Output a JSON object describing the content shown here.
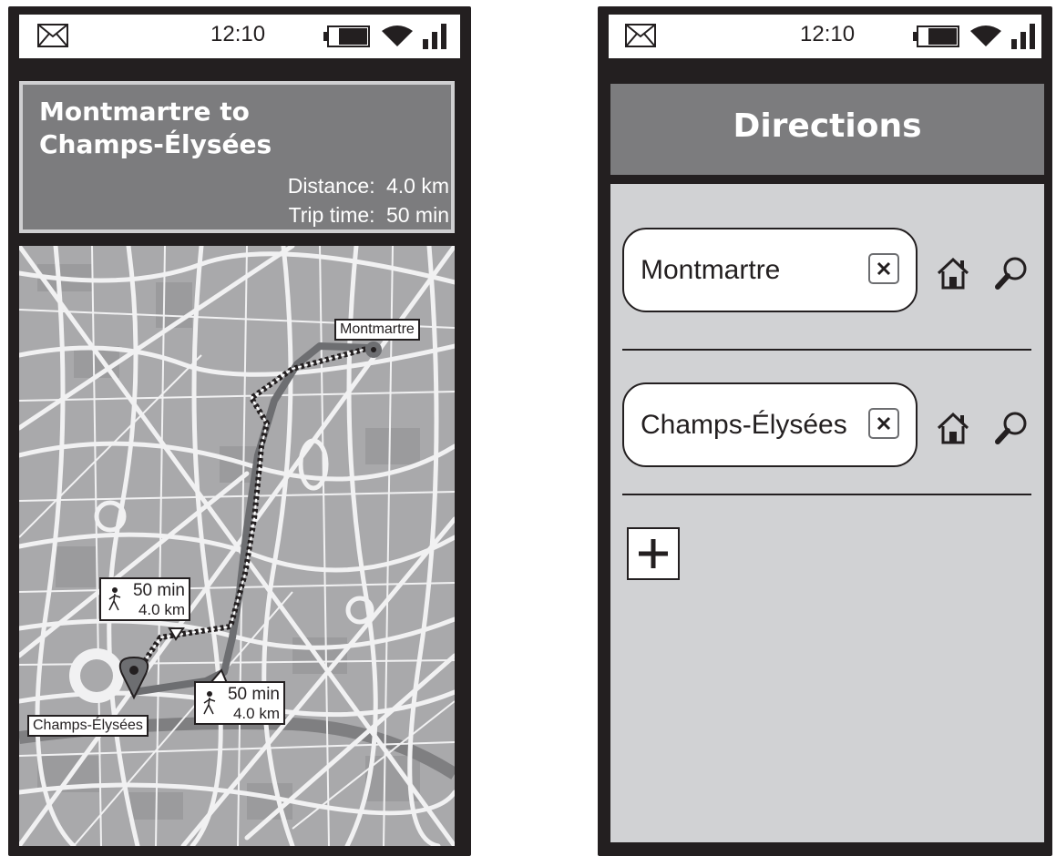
{
  "status_bar": {
    "time": "12:10",
    "icons": [
      "mail-icon",
      "battery-icon",
      "wifi-icon",
      "signal-icon"
    ]
  },
  "route_screen": {
    "title": "Montmartre to Champs-Élysées",
    "distance_label": "Distance:",
    "distance_value": "4.0 km",
    "trip_time_label": "Trip time:",
    "trip_time_value": "50 min",
    "map": {
      "origin_label": "Montmartre",
      "destination_label": "Champs-Élysées",
      "route_options": [
        {
          "mode": "walking",
          "style": "dashed",
          "time": "50 min",
          "distance": "4.0 km"
        },
        {
          "mode": "walking",
          "style": "solid",
          "time": "50 min",
          "distance": "4.0 km"
        }
      ]
    }
  },
  "directions_screen": {
    "title": "Directions",
    "stops": [
      {
        "value": "Montmartre",
        "icons": [
          "clear-icon",
          "home-icon",
          "search-icon"
        ]
      },
      {
        "value": "Champs-Élysées",
        "icons": [
          "clear-icon",
          "home-icon",
          "search-icon"
        ]
      }
    ],
    "add_stop_icon": "plus-icon"
  },
  "colors": {
    "frame": "#231f20",
    "header_gray": "#7c7c7e",
    "panel_gray": "#d1d2d4",
    "map_block": "#a9a9ab",
    "map_road": "#f1f1f2",
    "route_line": "#6d6e71"
  }
}
